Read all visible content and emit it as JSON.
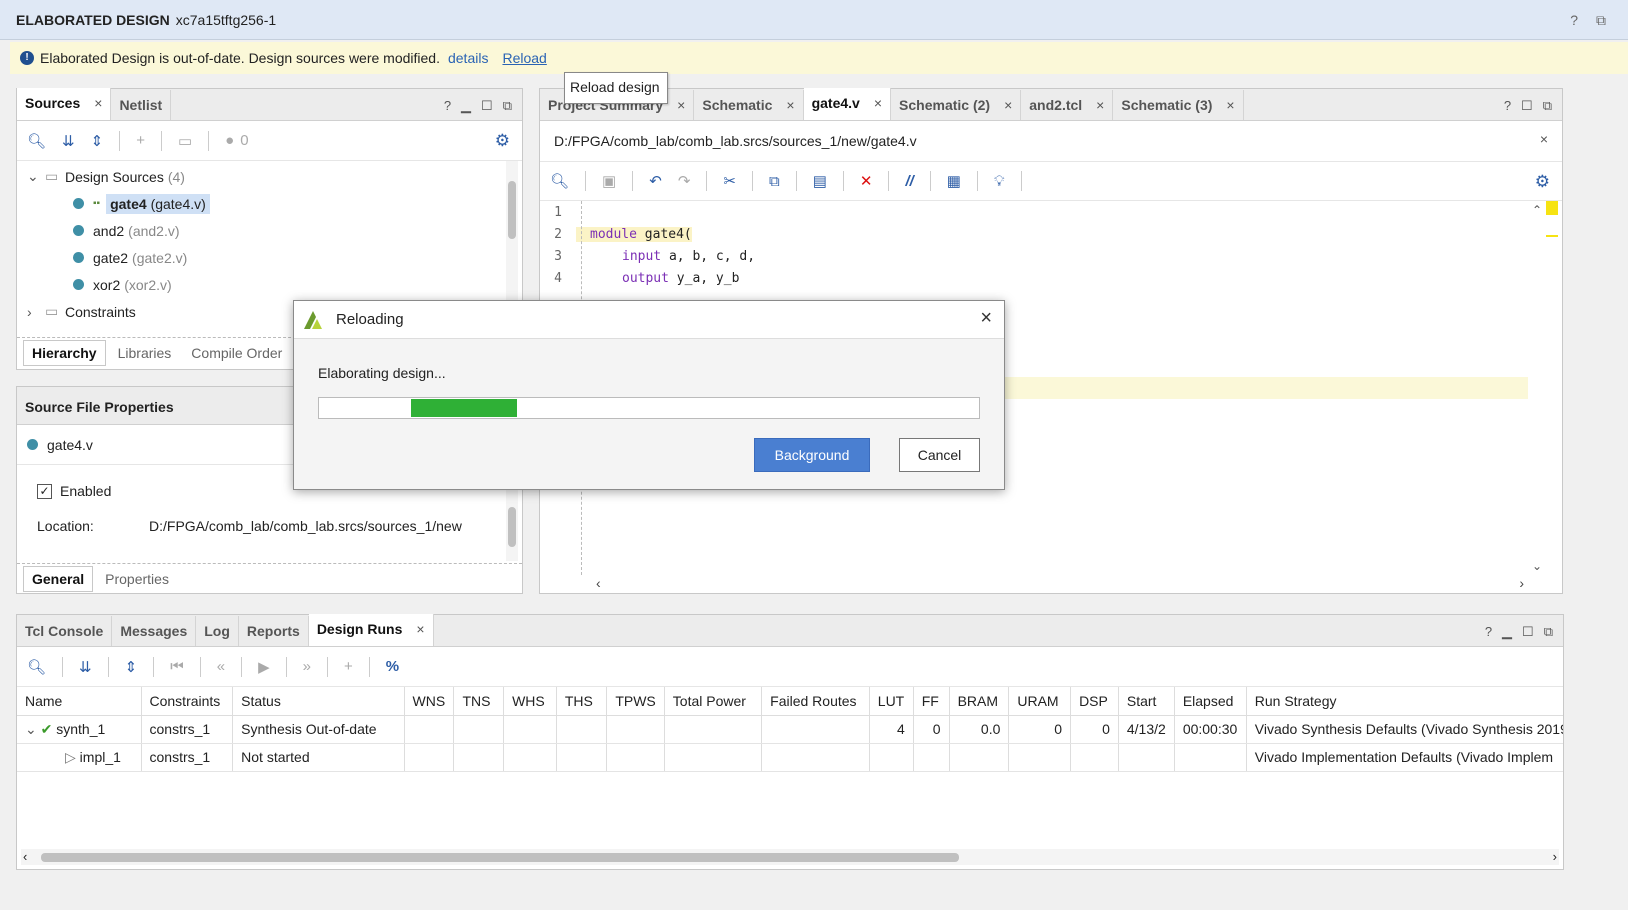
{
  "window": {
    "title": "ELABORATED DESIGN",
    "subtitle": "xc7a15tftg256-1",
    "help": "?",
    "restore": "⧉"
  },
  "banner": {
    "message": "Elaborated Design is out-of-date. Design sources were modified.",
    "details_link": "details",
    "reload_link": "Reload",
    "tooltip": "Reload design"
  },
  "sources_panel": {
    "tabs": [
      {
        "label": "Sources",
        "close": "×"
      },
      {
        "label": "Netlist"
      }
    ],
    "badge_count": "0",
    "tree": {
      "design_sources": "Design Sources",
      "design_sources_count": "(4)",
      "items": [
        {
          "name": "gate4",
          "file": "(gate4.v)"
        },
        {
          "name": "and2",
          "file": "(and2.v)"
        },
        {
          "name": "gate2",
          "file": "(gate2.v)"
        },
        {
          "name": "xor2",
          "file": "(xor2.v)"
        }
      ],
      "constraints": "Constraints"
    },
    "subtabs": [
      "Hierarchy",
      "Libraries",
      "Compile Order"
    ]
  },
  "file_props": {
    "title": "Source File Properties",
    "file": "gate4.v",
    "enabled_label": "Enabled",
    "location_label": "Location:",
    "location_value": "D:/FPGA/comb_lab/comb_lab.srcs/sources_1/new",
    "subtabs": [
      "General",
      "Properties"
    ]
  },
  "editor": {
    "tabs": [
      {
        "label": "Project Summary",
        "close": "×"
      },
      {
        "label": "Schematic",
        "close": "×"
      },
      {
        "label": "gate4.v",
        "close": "×"
      },
      {
        "label": "Schematic (2)",
        "close": "×"
      },
      {
        "label": "and2.tcl",
        "close": "×"
      },
      {
        "label": "Schematic (3)",
        "close": "×"
      }
    ],
    "path": "D:/FPGA/comb_lab/comb_lab.srcs/sources_1/new/gate4.v",
    "lines": [
      {
        "n": "1",
        "kw": "",
        "text": ""
      },
      {
        "n": "2",
        "kw": "module",
        "text": " gate4("
      },
      {
        "n": "3",
        "kw": "input",
        "text": " a, b, c, d,"
      },
      {
        "n": "4",
        "kw": "output",
        "text": " y_a, y_b"
      }
    ]
  },
  "bottom_panel": {
    "tabs": [
      {
        "label": "Tcl Console"
      },
      {
        "label": "Messages"
      },
      {
        "label": "Log"
      },
      {
        "label": "Reports"
      },
      {
        "label": "Design Runs",
        "close": "×"
      }
    ],
    "columns": [
      "Name",
      "Constraints",
      "Status",
      "WNS",
      "TNS",
      "WHS",
      "THS",
      "TPWS",
      "Total Power",
      "Failed Routes",
      "LUT",
      "FF",
      "BRAM",
      "URAM",
      "DSP",
      "Start",
      "Elapsed",
      "Run Strategy"
    ],
    "rows": [
      {
        "name": "synth_1",
        "constraints": "constrs_1",
        "status": "Synthesis Out-of-date",
        "wns": "",
        "tns": "",
        "whs": "",
        "ths": "",
        "tpws": "",
        "power": "",
        "failed": "",
        "lut": "4",
        "ff": "0",
        "bram": "0.0",
        "uram": "0",
        "dsp": "0",
        "start": "4/13/2",
        "elapsed": "00:00:30",
        "strategy": "Vivado Synthesis Defaults (Vivado Synthesis 2019"
      },
      {
        "name": "impl_1",
        "constraints": "constrs_1",
        "status": "Not started",
        "wns": "",
        "tns": "",
        "whs": "",
        "ths": "",
        "tpws": "",
        "power": "",
        "failed": "",
        "lut": "",
        "ff": "",
        "bram": "",
        "uram": "",
        "dsp": "",
        "start": "",
        "elapsed": "",
        "strategy": "Vivado Implementation Defaults (Vivado Implem"
      }
    ]
  },
  "dialog": {
    "title": "Reloading",
    "message": "Elaborating design...",
    "progress_start": 0.14,
    "progress_end": 0.3,
    "background_button": "Background",
    "cancel_button": "Cancel",
    "close": "×",
    "progress_color": "#2fb036"
  },
  "colors": {
    "accent": "#2d5da6",
    "banner_bg": "#fbf8d8",
    "source_dot": "#3f8fa6",
    "primary_button": "#4a7fd1"
  }
}
